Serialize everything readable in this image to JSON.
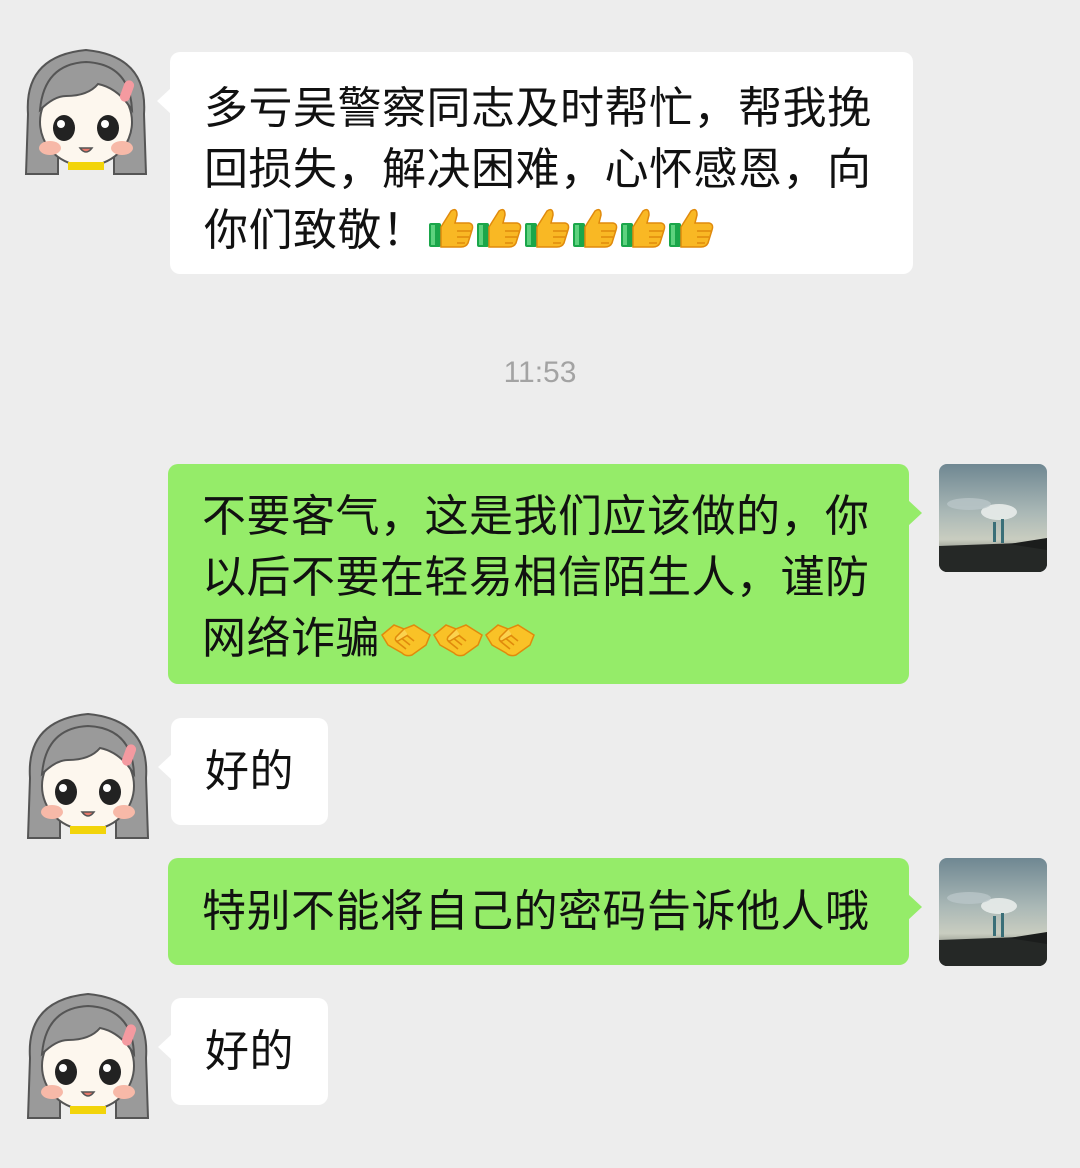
{
  "messages": [
    {
      "from": "contact",
      "text": "多亏吴警察同志及时帮忙，帮我挽回损失，解决困难，心怀感恩，向你们致敬！",
      "emoji": "thumbs-up",
      "emoji_count": 6
    },
    {
      "from": "me",
      "text": "不要客气，这是我们应该做的，你以后不要在轻易相信陌生人，谨防网络诈骗",
      "emoji": "handshake",
      "emoji_count": 3
    },
    {
      "from": "contact",
      "text": "好的"
    },
    {
      "from": "me",
      "text": "特别不能将自己的密码告诉他人哦"
    },
    {
      "from": "contact",
      "text": "好的"
    }
  ],
  "timestamp": "11:53",
  "colors": {
    "background": "#ededed",
    "incoming_bubble": "#ffffff",
    "outgoing_bubble": "#95ec69",
    "timestamp": "#a3a3a3"
  },
  "avatars": {
    "contact": "girl-cartoon-avatar",
    "me": "sky-landscape-photo-avatar"
  }
}
